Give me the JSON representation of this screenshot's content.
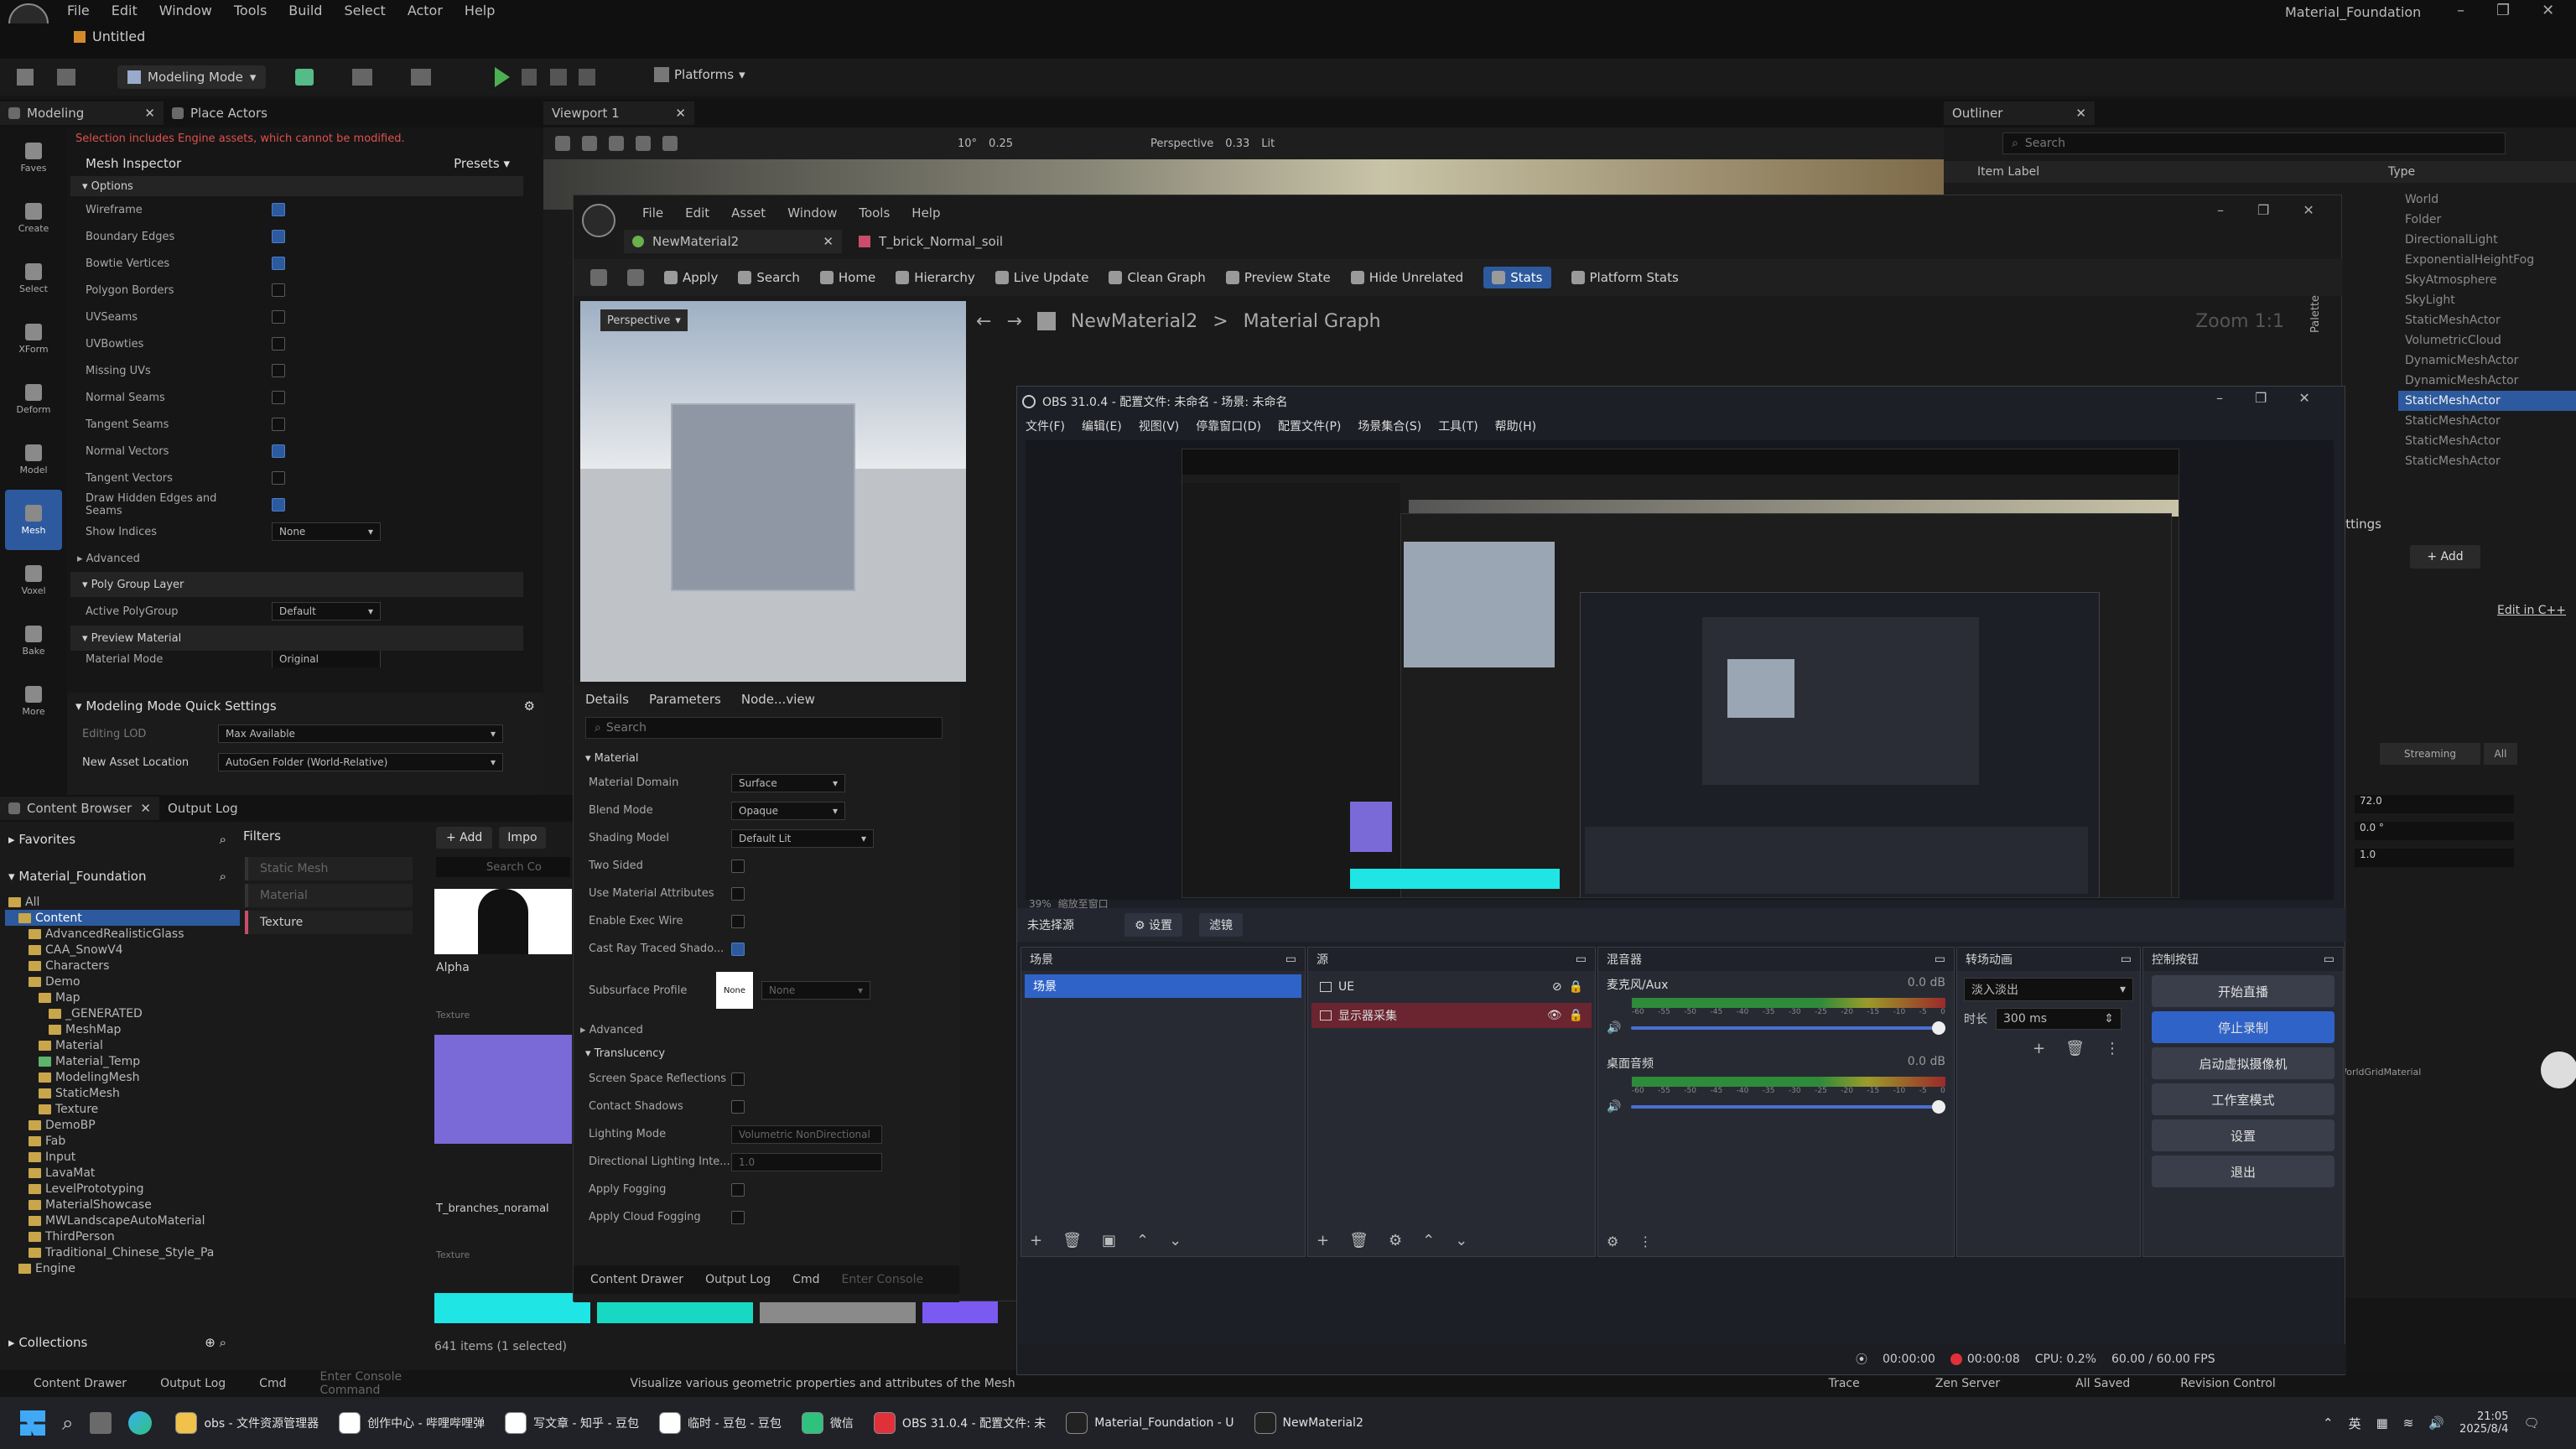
{
  "ue": {
    "menu": [
      "File",
      "Edit",
      "Window",
      "Tools",
      "Build",
      "Select",
      "Actor",
      "Help"
    ],
    "project_tab": "Untitled",
    "project_title": "Material_Foundation",
    "mode_label": "Modeling Mode",
    "platforms_label": "Platforms",
    "tabs": {
      "modeling": "Modeling",
      "place_actors": "Place Actors",
      "viewport": "Viewport 1",
      "outliner": "Outliner"
    },
    "warning": "Selection includes Engine assets, which cannot be modified.",
    "mesh_inspector": "Mesh Inspector",
    "presets": "Presets",
    "left_tools": [
      "Faves",
      "Create",
      "Select",
      "XForm",
      "Deform",
      "Model",
      "Mesh",
      "Voxel",
      "Bake",
      "More"
    ],
    "options_header": "Options",
    "options": [
      {
        "label": "Wireframe",
        "checked": true
      },
      {
        "label": "Boundary Edges",
        "checked": true
      },
      {
        "label": "Bowtie Vertices",
        "checked": true
      },
      {
        "label": "Polygon Borders",
        "checked": false
      },
      {
        "label": "UVSeams",
        "checked": false
      },
      {
        "label": "UVBowties",
        "checked": false
      },
      {
        "label": "Missing UVs",
        "checked": false
      },
      {
        "label": "Normal Seams",
        "checked": false
      },
      {
        "label": "Tangent Seams",
        "checked": false
      },
      {
        "label": "Normal Vectors",
        "checked": true
      },
      {
        "label": "Tangent Vectors",
        "checked": false
      },
      {
        "label": "Draw Hidden Edges and Seams",
        "checked": true
      }
    ],
    "show_indices": {
      "label": "Show Indices",
      "value": "None"
    },
    "advanced": "Advanced",
    "poly_group_layer": "Poly Group Layer",
    "active_polygroup": {
      "label": "Active PolyGroup",
      "value": "Default"
    },
    "preview_material": "Preview Material",
    "material_mode": {
      "label": "Material Mode",
      "value": "Original"
    },
    "quick_settings": "Modeling Mode Quick Settings",
    "editing_lod": {
      "label": "Editing LOD",
      "value": "Max Available"
    },
    "new_asset_location": {
      "label": "New Asset Location",
      "value": "AutoGen Folder (World-Relative)"
    },
    "viewport_toolbar": {
      "perspective": "Perspective",
      "fov": "0.33",
      "lit": "Lit",
      "snap_rot": "10°",
      "snap_scale": "0.25"
    },
    "outliner_search": "Search",
    "item_label": "Item Label",
    "type_header": "Type",
    "outliner_types": [
      "World",
      "Folder",
      "DirectionalLight",
      "ExponentialHeightFog",
      "SkyAtmosphere",
      "SkyLight",
      "StaticMeshActor",
      "VolumetricCloud",
      "DynamicMeshActor",
      "DynamicMeshActor",
      "StaticMeshActor",
      "StaticMeshActor",
      "StaticMeshActor",
      "StaticMeshActor"
    ],
    "details_right": {
      "settings": "ettings",
      "add": "+ Add",
      "edit_cpp": "Edit in C++",
      "streaming": "Streaming",
      "all": "All",
      "v1": "72.0",
      "v2": "0.0 °",
      "v3": "1.0",
      "grid_mat": "WorldGridMaterial"
    },
    "content_browser": "Content Browser",
    "output_log": "Output Log",
    "favorites": "Favorites",
    "material_foundation": "Material_Foundation",
    "add": "+ Add",
    "import": "Impo",
    "filters": "Filters",
    "filter_items": [
      "Static Mesh",
      "Material",
      "Texture"
    ],
    "search_placeholder": "Search Co",
    "tree": [
      {
        "name": "All",
        "depth": 0,
        "green": false
      },
      {
        "name": "Content",
        "depth": 1,
        "green": false,
        "selected": true
      },
      {
        "name": "AdvancedRealisticGlass",
        "depth": 2,
        "green": false
      },
      {
        "name": "CAA_SnowV4",
        "depth": 2,
        "green": false
      },
      {
        "name": "Characters",
        "depth": 2,
        "green": false
      },
      {
        "name": "Demo",
        "depth": 2,
        "green": false
      },
      {
        "name": "Map",
        "depth": 3,
        "green": false
      },
      {
        "name": "_GENERATED",
        "depth": 4,
        "green": false
      },
      {
        "name": "MeshMap",
        "depth": 4,
        "green": false
      },
      {
        "name": "Material",
        "depth": 3,
        "green": false
      },
      {
        "name": "Material_Temp",
        "depth": 3,
        "green": true
      },
      {
        "name": "ModelingMesh",
        "depth": 3,
        "green": false
      },
      {
        "name": "StaticMesh",
        "depth": 3,
        "green": false
      },
      {
        "name": "Texture",
        "depth": 3,
        "green": false
      },
      {
        "name": "DemoBP",
        "depth": 2,
        "green": false
      },
      {
        "name": "Fab",
        "depth": 2,
        "green": false
      },
      {
        "name": "Input",
        "depth": 2,
        "green": false
      },
      {
        "name": "LavaMat",
        "depth": 2,
        "green": false
      },
      {
        "name": "LevelPrototyping",
        "depth": 2,
        "green": false
      },
      {
        "name": "MaterialShowcase",
        "depth": 2,
        "green": false
      },
      {
        "name": "MWLandscapeAutoMaterial",
        "depth": 2,
        "green": false
      },
      {
        "name": "ThirdPerson",
        "depth": 2,
        "green": false
      },
      {
        "name": "Traditional_Chinese_Style_Pa",
        "depth": 2,
        "green": false
      },
      {
        "name": "Engine",
        "depth": 1,
        "green": false
      }
    ],
    "assets": [
      {
        "name": "Alpha",
        "type": "Texture"
      },
      {
        "name": "T_branches_noramal",
        "type": "Texture"
      }
    ],
    "items_count": "641 items (1 selected)",
    "collections": "Collections",
    "status": {
      "content_drawer": "Content Drawer",
      "output_log": "Output Log",
      "cmd": "Cmd",
      "console_placeholder": "Enter Console Command",
      "hint": "Visualize various geometric properties and attributes of the Mesh",
      "trace": "Trace",
      "zen": "Zen Server",
      "saved": "All Saved",
      "revision": "Revision Control"
    }
  },
  "mat": {
    "menu": [
      "File",
      "Edit",
      "Asset",
      "Window",
      "Tools",
      "Help"
    ],
    "tab1": "NewMaterial2",
    "tab2": "T_brick_Normal_soil",
    "toolbar": [
      "Apply",
      "Search",
      "Home",
      "Hierarchy",
      "Live Update",
      "Clean Graph",
      "Preview State",
      "Hide Unrelated",
      "Stats",
      "Platform Stats"
    ],
    "breadcrumb1": "NewMaterial2",
    "breadcrumb2": "Material Graph",
    "zoom": "Zoom 1:1",
    "palette": "Palette",
    "preview_mode": "Perspective",
    "details_tabs": [
      "Details",
      "Parameters",
      "Node...view"
    ],
    "search_placeholder": "Search",
    "section_material": "Material",
    "props": [
      {
        "label": "Material Domain",
        "value": "Surface"
      },
      {
        "label": "Blend Mode",
        "value": "Opaque"
      },
      {
        "label": "Shading Model",
        "value": "Default Lit"
      }
    ],
    "checks": [
      {
        "label": "Two Sided",
        "checked": false
      },
      {
        "label": "Use Material Attributes",
        "checked": false
      },
      {
        "label": "Enable Exec Wire",
        "checked": false
      },
      {
        "label": "Cast Ray Traced Shado...",
        "checked": true
      }
    ],
    "subsurface": {
      "label": "Subsurface Profile",
      "thumb": "None",
      "value": "None"
    },
    "advanced": "Advanced",
    "translucency": "Translucency",
    "trans_props": [
      {
        "label": "Screen Space Reflections"
      },
      {
        "label": "Contact Shadows"
      },
      {
        "label": "Lighting Mode",
        "value": "Volumetric NonDirectional"
      },
      {
        "label": "Directional Lighting Inte...",
        "value": "1.0"
      },
      {
        "label": "Apply Fogging"
      },
      {
        "label": "Apply Cloud Fogging"
      }
    ],
    "bottom": {
      "content_drawer": "Content Drawer",
      "output_log": "Output Log",
      "cmd": "Cmd",
      "console": "Enter Console"
    }
  },
  "obs": {
    "title": "OBS 31.0.4 - 配置文件: 未命名 - 场景: 未命名",
    "menu": [
      "文件(F)",
      "编辑(E)",
      "视图(V)",
      "停靠窗口(D)",
      "配置文件(P)",
      "场景集合(S)",
      "工具(T)",
      "帮助(H)"
    ],
    "zoom": "39%",
    "zoom_label": "缩放至窗口",
    "no_source": "未选择源",
    "settings_btn": "设置",
    "filter_btn": "滤镜",
    "docks": {
      "scenes": "场景",
      "sources": "源",
      "mixer": "混音器",
      "transitions": "转场动画",
      "controls": "控制按钮"
    },
    "scene_item": "场景",
    "sources": [
      {
        "name": "UE",
        "visible": false
      },
      {
        "name": "显示器采集",
        "visible": true,
        "selected": true
      }
    ],
    "mixer": [
      {
        "name": "麦克风/Aux",
        "db": "0.0 dB"
      },
      {
        "name": "桌面音频",
        "db": "0.0 dB"
      }
    ],
    "meter_scale": [
      "-60",
      "-55",
      "-50",
      "-45",
      "-40",
      "-35",
      "-30",
      "-25",
      "-20",
      "-15",
      "-10",
      "-5",
      "0"
    ],
    "transition": {
      "type": "淡入淡出",
      "duration_label": "时长",
      "duration": "300 ms"
    },
    "controls": [
      "开始直播",
      "停止录制",
      "启动虚拟摄像机",
      "工作室模式",
      "设置",
      "退出"
    ],
    "status": {
      "stream_time": "00:00:00",
      "rec_time": "00:00:08",
      "cpu": "CPU: 0.2%",
      "fps": "60.00 / 60.00 FPS"
    }
  },
  "taskbar": {
    "apps": [
      "obs - 文件资源管理器",
      "创作中心 - 哔哩哔哩弹",
      "写文章 - 知乎 - 豆包",
      "临时 - 豆包 - 豆包",
      "微信",
      "OBS 31.0.4 - 配置文件: 未",
      "Material_Foundation - U",
      "NewMaterial2"
    ],
    "ime": "英",
    "time": "21:05",
    "date": "2025/8/4"
  },
  "colors": {
    "accent": "#2d5a9e",
    "obs_bg": "#1d1f26",
    "obs_stop": "#2f63c8",
    "ue_panel": "#1e1e1e"
  }
}
